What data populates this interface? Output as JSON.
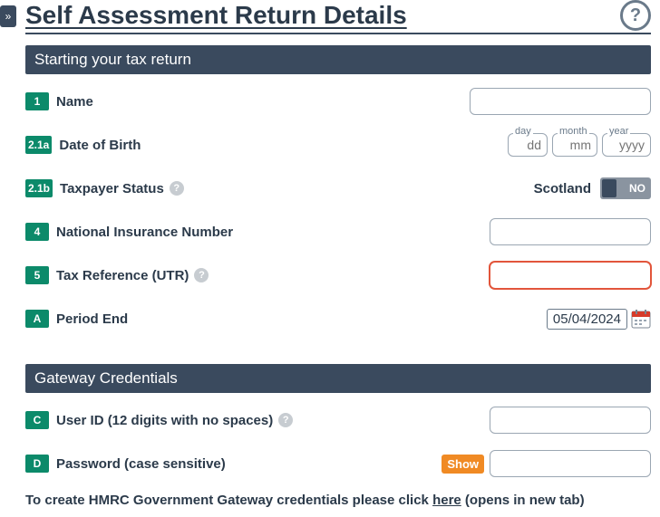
{
  "chevron": "»",
  "title": "Self Assessment Return Details",
  "help_icon_glyph": "?",
  "section1": {
    "header": "Starting your tax return",
    "name": {
      "num": "1",
      "label": "Name",
      "value": ""
    },
    "dob": {
      "num": "2.1a",
      "label": "Date of Birth",
      "day_legend": "day",
      "day_ph": "dd",
      "month_legend": "month",
      "month_ph": "mm",
      "year_legend": "year",
      "year_ph": "yyyy"
    },
    "taxpayer_status": {
      "num": "2.1b",
      "label": "Taxpayer Status",
      "region": "Scotland",
      "toggle_value": "NO"
    },
    "nino": {
      "num": "4",
      "label": "National Insurance Number",
      "value": ""
    },
    "utr": {
      "num": "5",
      "label": "Tax Reference (UTR)",
      "value": ""
    },
    "period_end": {
      "num": "A",
      "label": "Period End",
      "value": "05/04/2024"
    }
  },
  "section2": {
    "header": "Gateway Credentials",
    "user_id": {
      "num": "C",
      "label": "User ID (12 digits with no spaces)",
      "value": ""
    },
    "password": {
      "num": "D",
      "label": "Password (case sensitive)",
      "show_label": "Show",
      "value": ""
    }
  },
  "footer": {
    "prefix": "To create HMRC Government Gateway credentials please click ",
    "link": "here",
    "suffix": " (opens in new tab)"
  }
}
